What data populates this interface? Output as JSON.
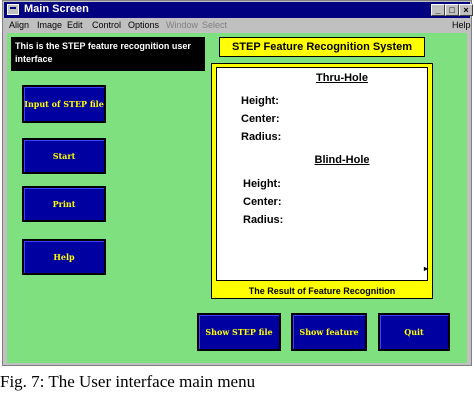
{
  "window": {
    "title": "Main Screen",
    "controls": {
      "minimize": "_",
      "maximize": "□",
      "close": "×"
    }
  },
  "menubar": {
    "items": [
      "Align",
      "Image",
      "Edit",
      "Control",
      "Options",
      "Window",
      "Select"
    ],
    "help": "Help"
  },
  "info_text": "This is the STEP feature recognition user interface",
  "system_title": "STEP Feature Recognition System",
  "result": {
    "thru_hole": {
      "header": "Thru-Hole",
      "height": "Height:",
      "center": "Center:",
      "radius": "Radius:"
    },
    "blind_hole": {
      "header": "Blind-Hole",
      "height": "Height:",
      "center": "Center:",
      "radius": "Radius:"
    },
    "caption": "The Result of Feature Recognition"
  },
  "buttons": {
    "input_step": "Input of STEP file",
    "start": "Start",
    "print": "Print",
    "help": "Help",
    "show_step": "Show STEP file",
    "show_feature": "Show feature",
    "quit": "Quit"
  },
  "figure_caption": "Fig. 7: The User interface main menu",
  "colors": {
    "client_bg": "#7ee07e",
    "button_bg": "#0000a0",
    "button_text": "#ffff00",
    "title_bg": "#ffff00",
    "titlebar_bg": "#000080"
  }
}
